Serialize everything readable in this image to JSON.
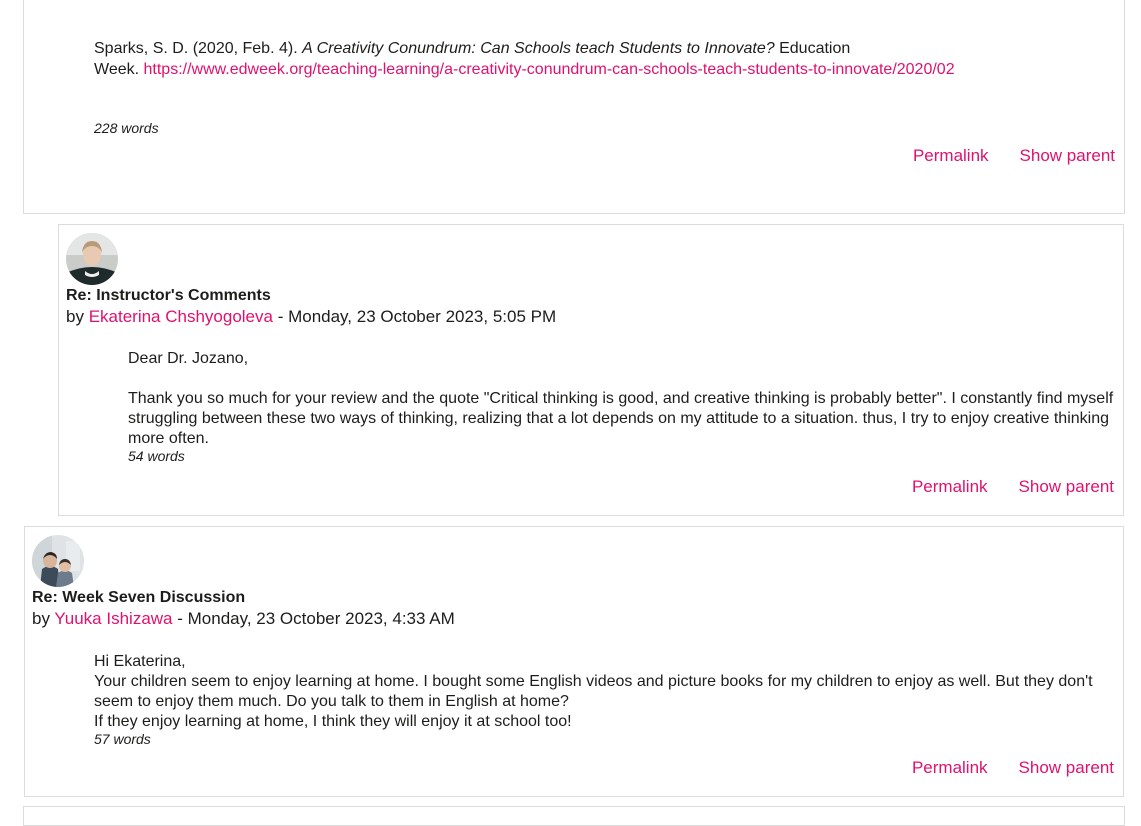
{
  "top_post": {
    "ref_author": "Sparks, S. D. (2020, Feb. 4). ",
    "ref_title": "A Creativity Conundrum: Can Schools teach Students to Innovate?",
    "ref_after_title": " Education",
    "ref_week": "Week. ",
    "ref_url": "https://www.edweek.org/teaching-learning/a-creativity-conundrum-can-schools-teach-students-to-innovate/2020/02",
    "word_count": "228 words",
    "permalink": "Permalink",
    "show_parent": "Show parent"
  },
  "reply_post": {
    "subject": "Re: Instructor's Comments",
    "by_prefix": "by ",
    "author": "Ekaterina Chshyogoleva",
    "date": " - Monday, 23 October 2023, 5:05 PM",
    "greeting": "Dear Dr. Jozano,",
    "paragraph": "Thank you so much for your review and the quote \"Critical thinking is good, and creative thinking is probably better\". I constantly find myself struggling between these two ways of thinking, realizing that a lot depends on my attitude to a situation. thus, I try to enjoy creative thinking more often.",
    "word_count": "54 words",
    "permalink": "Permalink",
    "show_parent": "Show parent"
  },
  "yuuka_post": {
    "subject": "Re: Week Seven Discussion",
    "by_prefix": "by ",
    "author": "Yuuka Ishizawa",
    "date": " - Monday, 23 October 2023, 4:33 AM",
    "line1": "Hi Ekaterina,",
    "line2": "Your children seem to enjoy learning at home. I bought some English videos and picture books for my children to enjoy as well. But they don't seem to enjoy them much. Do you talk to them in English at home?",
    "line3": "If they enjoy learning at home, I think they will enjoy it at school too!",
    "word_count": "57 words",
    "permalink": "Permalink",
    "show_parent": "Show parent"
  },
  "colors": {
    "link": "#e0116f",
    "border": "#dcdcdc",
    "text": "#1d1d1b"
  },
  "icons": {
    "reply_avatar": "user-avatar-woman",
    "yuuka_avatar": "user-avatar-family"
  }
}
